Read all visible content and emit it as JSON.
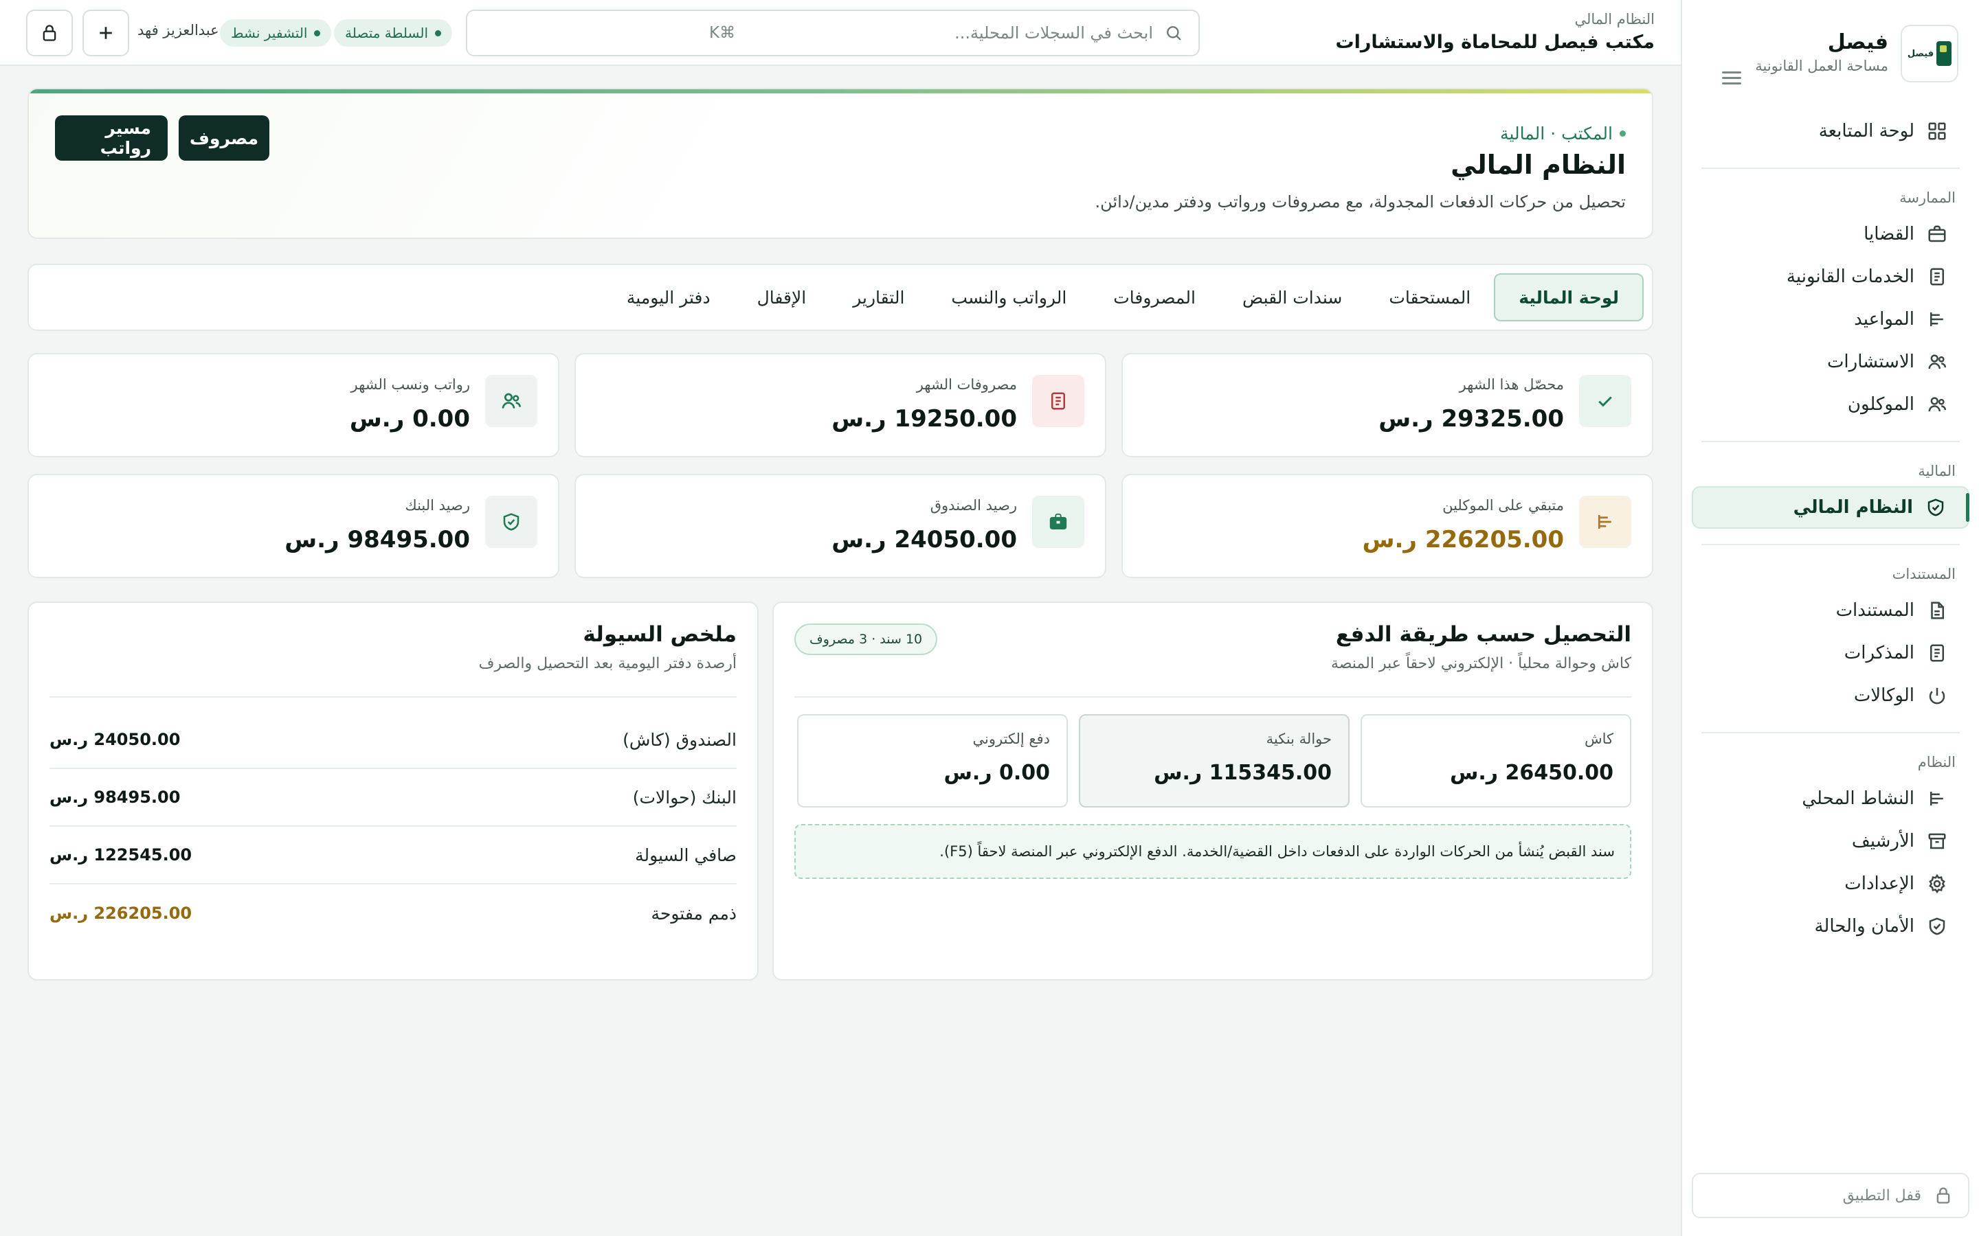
{
  "colors": {
    "accent": "#1f7a55",
    "dark": "#102c26",
    "warning": "#946a0c",
    "danger": "#b23b3b",
    "gold": "#a8792a"
  },
  "sidebar": {
    "brand_name": "فيصل",
    "brand_sub": "مساحة العمل القانونية",
    "logo_text": "فيصل",
    "dashboard": {
      "label": "لوحة المتابعة",
      "icon": "grid-icon"
    },
    "sections": [
      {
        "title": "الممارسة",
        "items": [
          {
            "label": "القضايا",
            "icon": "briefcase-icon"
          },
          {
            "label": "الخدمات القانونية",
            "icon": "document-icon"
          },
          {
            "label": "المواعيد",
            "icon": "timeline-icon"
          },
          {
            "label": "الاستشارات",
            "icon": "users-icon"
          },
          {
            "label": "الموكلون",
            "icon": "users-icon"
          }
        ]
      },
      {
        "title": "المالية",
        "items": [
          {
            "label": "النظام المالي",
            "icon": "shield-check-icon",
            "active": true
          }
        ]
      },
      {
        "title": "المستندات",
        "items": [
          {
            "label": "المستندات",
            "icon": "file-icon"
          },
          {
            "label": "المذكرات",
            "icon": "document-icon"
          },
          {
            "label": "الوكالات",
            "icon": "power-icon"
          }
        ]
      },
      {
        "title": "النظام",
        "items": [
          {
            "label": "النشاط المحلي",
            "icon": "timeline-icon"
          },
          {
            "label": "الأرشيف",
            "icon": "archive-icon"
          },
          {
            "label": "الإعدادات",
            "icon": "gear-icon"
          },
          {
            "label": "الأمان والحالة",
            "icon": "shield-check-icon"
          }
        ]
      }
    ],
    "lock_label": "قفل التطبيق"
  },
  "topbar": {
    "crumb_small": "النظام المالي",
    "crumb_title": "مكتب فيصل للمحاماة والاستشارات",
    "search_placeholder": "ابحث في السجلات المحلية...",
    "search_shortcut": "⌘K",
    "status_authority": "السلطة متصلة",
    "status_encryption": "التشفير نشط",
    "user_name": "عبدالعزيز فهد"
  },
  "hero": {
    "crumb": "المكتب · المالية",
    "title": "النظام المالي",
    "description": "تحصيل من حركات الدفعات المجدولة، مع مصروفات ورواتب ودفتر مدين/دائن.",
    "btn_expense": "مصروف",
    "btn_payroll": "مسير رواتب"
  },
  "tabs": [
    "لوحة المالية",
    "المستحقات",
    "سندات القبض",
    "المصروفات",
    "الرواتب والنسب",
    "التقارير",
    "الإقفال",
    "دفتر اليومية"
  ],
  "stats": [
    {
      "label": "محصّل هذا الشهر",
      "value": "29325.00 ر.س",
      "icon": "check-icon",
      "tone": "green"
    },
    {
      "label": "مصروفات الشهر",
      "value": "19250.00 ر.س",
      "icon": "receipt-icon",
      "tone": "red"
    },
    {
      "label": "رواتب ونسب الشهر",
      "value": "0.00 ر.س",
      "icon": "users-icon",
      "tone": "green"
    },
    {
      "label": "متبقي على الموكلين",
      "value": "226205.00 ر.س",
      "icon": "timeline-icon",
      "tone": "gold",
      "warn": true
    },
    {
      "label": "رصيد الصندوق",
      "value": "24050.00 ر.س",
      "icon": "briefcase-icon",
      "tone": "green"
    },
    {
      "label": "رصيد البنك",
      "value": "98495.00 ر.س",
      "icon": "shield-check-icon",
      "tone": "green"
    }
  ],
  "collection": {
    "title": "التحصيل حسب طريقة الدفع",
    "subtitle": "كاش وحوالة محلياً · الإلكتروني لاحقاً عبر المنصة",
    "badge": "10 سند · 3 مصروف",
    "methods": [
      {
        "label": "كاش",
        "value": "26450.00 ر.س"
      },
      {
        "label": "حوالة بنكية",
        "value": "115345.00 ر.س"
      },
      {
        "label": "دفع إلكتروني",
        "value": "0.00 ر.س"
      }
    ],
    "note": "سند القبض يُنشأ من الحركات الواردة على الدفعات داخل القضية/الخدمة. الدفع الإلكتروني عبر المنصة لاحقاً (F5)."
  },
  "liquidity": {
    "title": "ملخص السيولة",
    "subtitle": "أرصدة دفتر اليومية بعد التحصيل والصرف",
    "rows": [
      {
        "label": "الصندوق (كاش)",
        "value": "24050.00 ر.س"
      },
      {
        "label": "البنك (حوالات)",
        "value": "98495.00 ر.س"
      },
      {
        "label": "صافي السيولة",
        "value": "122545.00 ر.س"
      },
      {
        "label": "ذمم مفتوحة",
        "value": "226205.00 ر.س",
        "warn": true
      }
    ]
  }
}
